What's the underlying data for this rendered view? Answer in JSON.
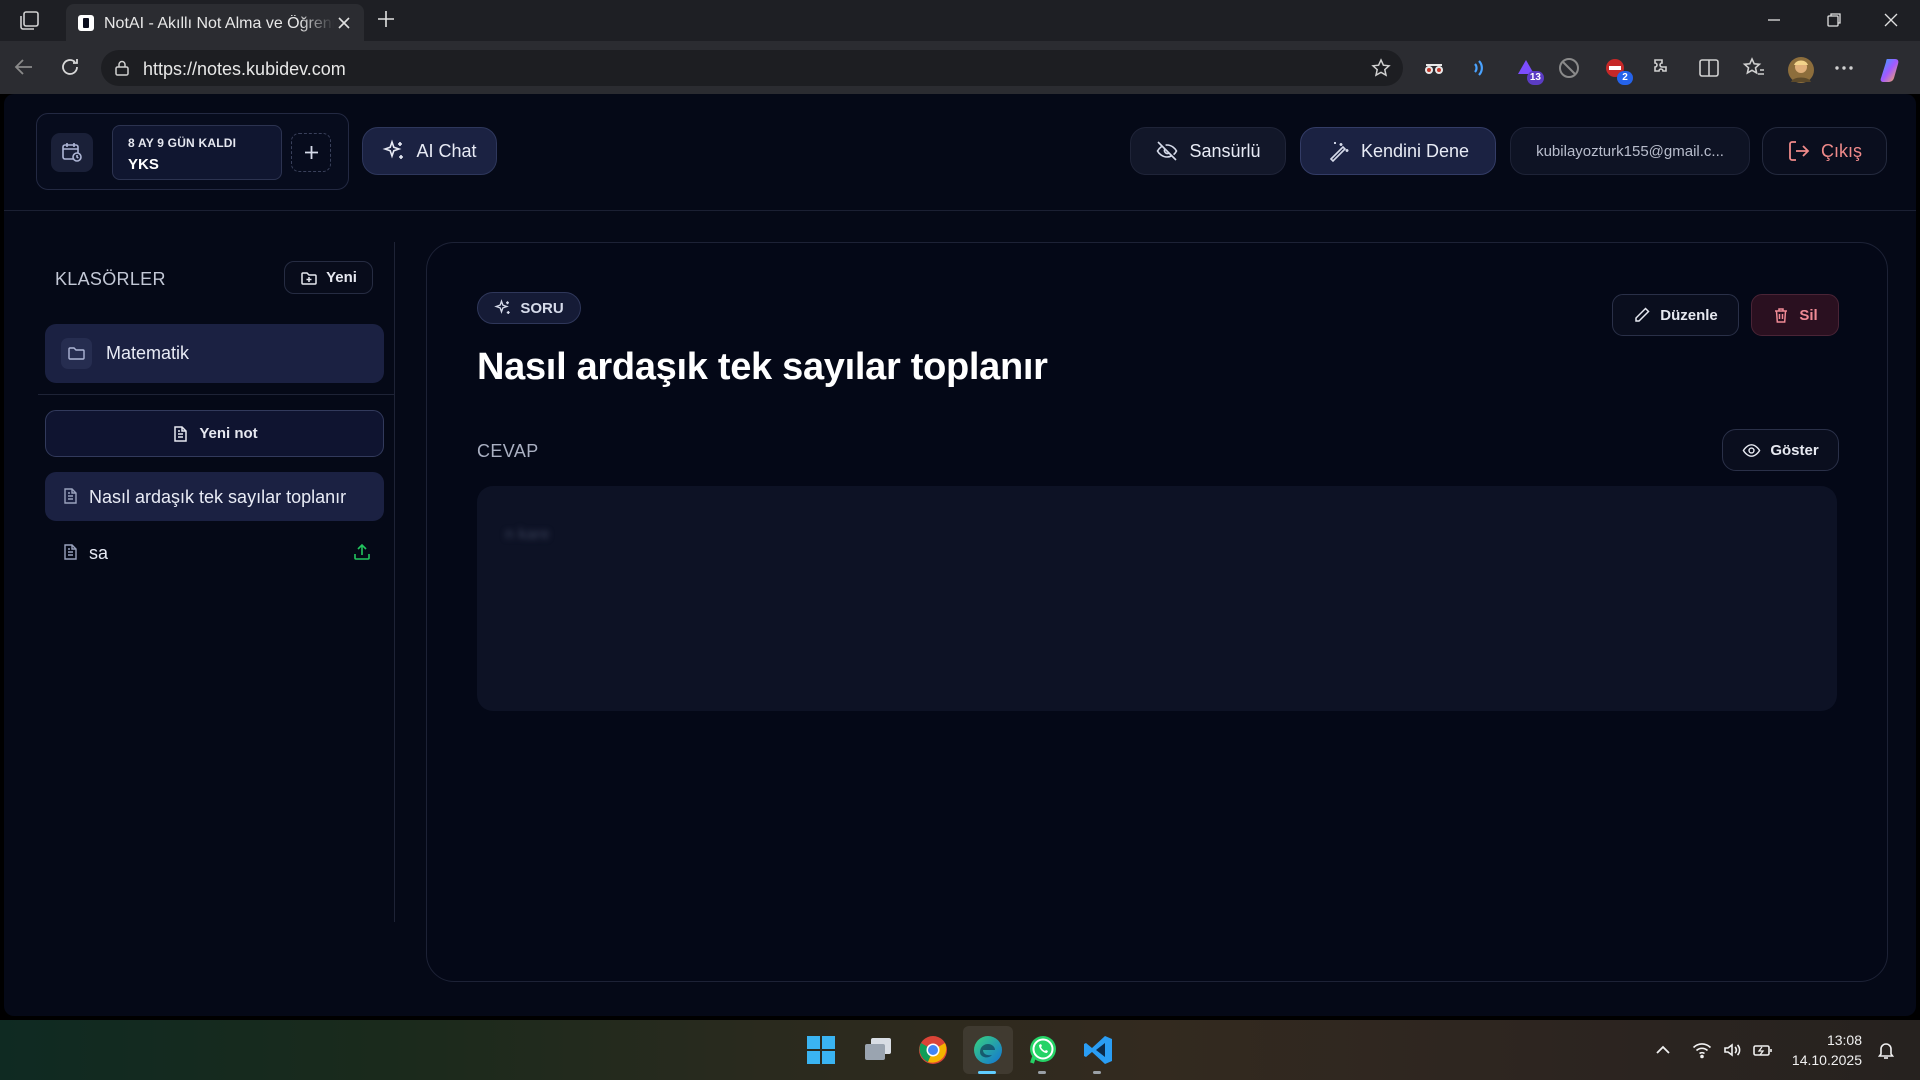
{
  "browser": {
    "tab_title": "NotAI - Akıllı Not Alma ve Öğrenme",
    "url": "https://notes.kubidev.com",
    "extensions": [
      {
        "name": "glasses-extension-icon"
      },
      {
        "name": "read-aloud-extension-icon"
      },
      {
        "name": "purple-extension-icon",
        "badge": "13"
      },
      {
        "name": "blocked-extension-icon"
      },
      {
        "name": "red-extension-icon",
        "badge": "2"
      }
    ]
  },
  "header": {
    "countdown": {
      "days_left": "8 AY 9 GÜN KALDI",
      "exam_name": "YKS"
    },
    "ai_chat_label": "AI Chat",
    "censored_label": "Sansürlü",
    "try_yourself_label": "Kendini Dene",
    "user_email": "kubilayozturk155@gmail.c...",
    "logout_label": "Çıkış"
  },
  "sidebar": {
    "title": "KLASÖRLER",
    "new_folder_label": "Yeni",
    "folders": [
      {
        "label": "Matematik"
      }
    ],
    "new_note_label": "Yeni not",
    "notes": [
      {
        "label": "Nasıl ardaşık tek sayılar toplanır",
        "active": true
      },
      {
        "label": "sa",
        "active": false
      }
    ]
  },
  "note": {
    "type_badge": "SORU",
    "title": "Nasıl ardaşık tek sayılar toplanır",
    "edit_label": "Düzenle",
    "delete_label": "Sil",
    "answer_label": "CEVAP",
    "show_label": "Göster",
    "answer_text": "n kare"
  },
  "taskbar": {
    "apps": [
      "windows-start",
      "file-explorer",
      "chrome",
      "edge",
      "whatsapp",
      "vscode"
    ],
    "time": "13:08",
    "date": "14.10.2025"
  },
  "colors": {
    "app_bg": "#050917",
    "accent_surface": "#1b2142",
    "danger": "#f08a95",
    "success": "#22c55e"
  }
}
